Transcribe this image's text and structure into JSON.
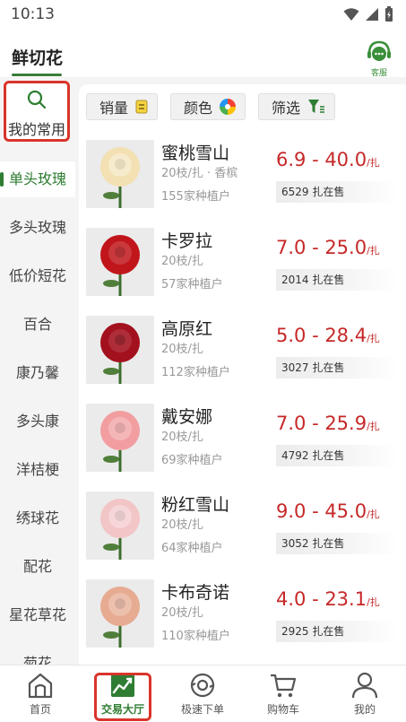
{
  "status_bar": {
    "time": "10:13"
  },
  "header": {
    "title": "鲜切花",
    "service_label": "客服"
  },
  "sidebar": {
    "favorites_label": "我的常用",
    "categories": [
      "单头玫瑰",
      "多头玫瑰",
      "低价短花",
      "百合",
      "康乃馨",
      "多头康",
      "洋桔梗",
      "绣球花",
      "配花",
      "星花草花",
      "菊花"
    ],
    "active_index": 0
  },
  "filters": [
    {
      "label": "销量",
      "icon": "sales-icon"
    },
    {
      "label": "颜色",
      "icon": "color-wheel-icon"
    },
    {
      "label": "筛选",
      "icon": "filter-icon"
    }
  ],
  "products": [
    {
      "name": "蜜桃雪山",
      "spec": "20枝/扎 · 香槟",
      "growers": "155家种植户",
      "price": "6.9 - 40.0",
      "unit": "/扎",
      "stock": "6529 扎在售",
      "color": "#f3e0b3"
    },
    {
      "name": "卡罗拉",
      "spec": "20枝/扎",
      "growers": "57家种植户",
      "price": "7.0 - 25.0",
      "unit": "/扎",
      "stock": "2014 扎在售",
      "color": "#c0161b"
    },
    {
      "name": "高原红",
      "spec": "20枝/扎",
      "growers": "112家种植户",
      "price": "5.0 - 28.4",
      "unit": "/扎",
      "stock": "3027 扎在售",
      "color": "#a3111e"
    },
    {
      "name": "戴安娜",
      "spec": "20枝/扎",
      "growers": "69家种植户",
      "price": "7.0 - 25.9",
      "unit": "/扎",
      "stock": "4792 扎在售",
      "color": "#f29ea1"
    },
    {
      "name": "粉红雪山",
      "spec": "20枝/扎",
      "growers": "64家种植户",
      "price": "9.0 - 45.0",
      "unit": "/扎",
      "stock": "3052 扎在售",
      "color": "#f2c5c7"
    },
    {
      "name": "卡布奇诺",
      "spec": "20枝/扎",
      "growers": "110家种植户",
      "price": "4.0 - 23.1",
      "unit": "/扎",
      "stock": "2925 扎在售",
      "color": "#e7ab92"
    }
  ],
  "bottom_nav": [
    {
      "label": "首页",
      "icon": "home-icon"
    },
    {
      "label": "交易大厅",
      "icon": "trading-hall-icon",
      "active": true
    },
    {
      "label": "极速下单",
      "icon": "quick-order-icon"
    },
    {
      "label": "购物车",
      "icon": "cart-icon"
    },
    {
      "label": "我的",
      "icon": "profile-icon"
    }
  ],
  "colors": {
    "accent_green": "#2e7d32",
    "price_red": "#c62828",
    "highlight_red": "#d9342b"
  }
}
